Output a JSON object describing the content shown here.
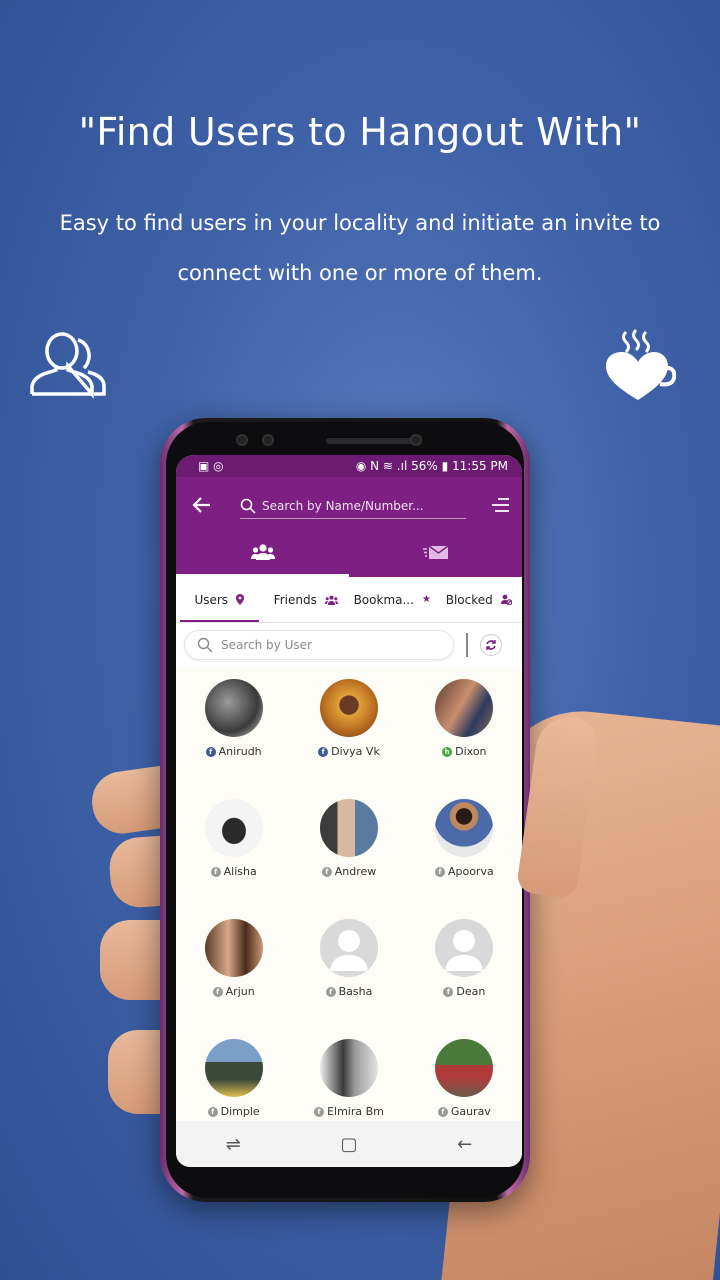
{
  "hero": {
    "title": "\"Find Users to Hangout With\"",
    "line1": "Easy to find users in your locality and initiate an invite to",
    "line2": "connect with one or more of them."
  },
  "status": {
    "left_icons": "▣ ◎",
    "right": "◉ N ≋ .ıl 56% ▮ 11:55 PM"
  },
  "appbar": {
    "search_placeholder": "Search by Name/Number...",
    "tabs": [
      {
        "icon": "group-icon"
      },
      {
        "icon": "mail-icon"
      }
    ]
  },
  "subtabs": [
    {
      "label": "Users",
      "icon": "location-pin-icon",
      "glyph": "⬤"
    },
    {
      "label": "Friends",
      "icon": "friends-icon",
      "glyph": "♟"
    },
    {
      "label": "Bookma...",
      "icon": "star-icon",
      "glyph": "★"
    },
    {
      "label": "Blocked",
      "icon": "blocked-user-icon",
      "glyph": "♙"
    }
  ],
  "user_search": {
    "placeholder": "Search by User"
  },
  "users": [
    {
      "name": "Anirudh",
      "source": "facebook"
    },
    {
      "name": "Divya Vk",
      "source": "facebook"
    },
    {
      "name": "Dixon",
      "source": "hangout"
    },
    {
      "name": "Alisha",
      "source": "grey"
    },
    {
      "name": "Andrew",
      "source": "grey"
    },
    {
      "name": "Apoorva",
      "source": "grey"
    },
    {
      "name": "Arjun",
      "source": "grey"
    },
    {
      "name": "Basha",
      "source": "grey"
    },
    {
      "name": "Dean",
      "source": "grey"
    },
    {
      "name": "Dimple",
      "source": "grey"
    },
    {
      "name": "Elmira Bm",
      "source": "grey"
    },
    {
      "name": "Gaurav",
      "source": "grey"
    }
  ],
  "navbar": {
    "recent": "⇌",
    "home": "▢",
    "back": "←"
  },
  "colors": {
    "primary": "#7e1f83",
    "statusbar": "#6b1c72",
    "background": "#3f62a8"
  }
}
